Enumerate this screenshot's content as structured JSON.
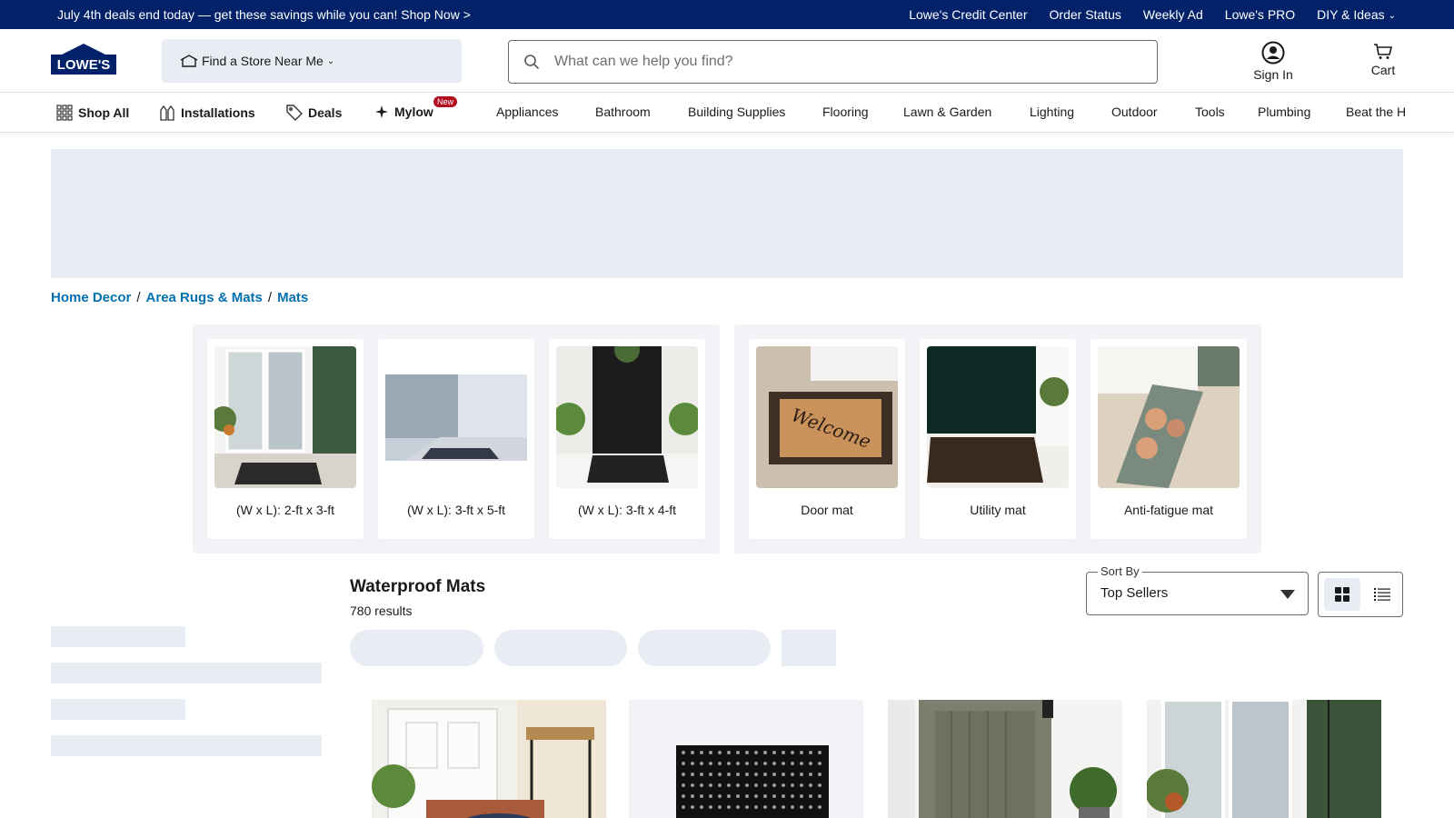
{
  "promo": {
    "text": "July 4th deals end today — get these savings while you can! Shop Now >",
    "links": [
      "Lowe's Credit Center",
      "Order Status",
      "Weekly Ad",
      "Lowe's PRO",
      "DIY & Ideas"
    ]
  },
  "header": {
    "logo_text": "LOWE'S",
    "store_label": "Find a Store Near Me",
    "search_placeholder": "What can we help you find?",
    "signin_label": "Sign In",
    "cart_label": "Cart"
  },
  "nav": {
    "shop_all": "Shop All",
    "installations": "Installations",
    "deals": "Deals",
    "mylow": "Mylow",
    "new_badge": "New",
    "categories": [
      "Appliances",
      "Bathroom",
      "Building Supplies",
      "Flooring",
      "Lawn & Garden",
      "Lighting",
      "Outdoor",
      "Tools",
      "Plumbing",
      "Beat the H"
    ]
  },
  "breadcrumb": [
    "Home Decor",
    "Area Rugs & Mats",
    "Mats"
  ],
  "size_cards": [
    {
      "label": "(W x L): 2-ft x 3-ft"
    },
    {
      "label": "(W x L): 3-ft x 5-ft"
    },
    {
      "label": "(W x L): 3-ft x 4-ft"
    }
  ],
  "type_cards": [
    {
      "label": "Door mat"
    },
    {
      "label": "Utility mat"
    },
    {
      "label": "Anti-fatigue mat"
    }
  ],
  "results": {
    "title": "Waterproof Mats",
    "count": "780 results"
  },
  "sort": {
    "legend": "Sort By",
    "value": "Top Sellers"
  },
  "colors": {
    "brand_navy": "#012169",
    "link_blue": "#0471af",
    "skeleton": "#e8ecf3",
    "badge_red": "#b10d1f"
  }
}
